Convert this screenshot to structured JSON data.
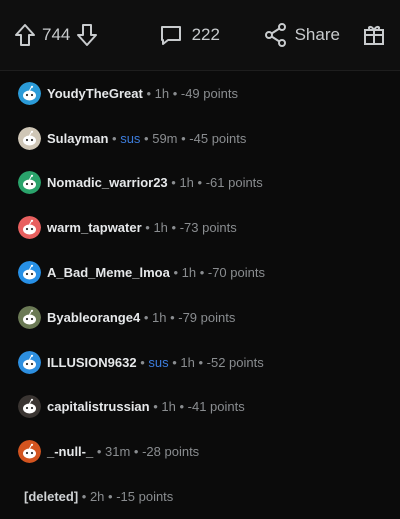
{
  "actions": {
    "upvotes": "744",
    "comments": "222",
    "share_label": "Share"
  },
  "colors": {
    "background": "#0b0b0b",
    "meta": "#8a8d90",
    "flair": "#3d7ddc"
  },
  "comments": [
    {
      "user": "YoudyTheGreat",
      "flair": "",
      "time": "1h",
      "points": "-49 points",
      "avatar_color": "#2b9bd8"
    },
    {
      "user": "Sulayman",
      "flair": "sus",
      "time": "59m",
      "points": "-45 points",
      "avatar_color": "#cfc6b6"
    },
    {
      "user": "Nomadic_warrior23",
      "flair": "",
      "time": "1h",
      "points": "-61 points",
      "avatar_color": "#2aa36b"
    },
    {
      "user": "warm_tapwater",
      "flair": "",
      "time": "1h",
      "points": "-73 points",
      "avatar_color": "#e8605f"
    },
    {
      "user": "A_Bad_Meme_lmoa",
      "flair": "",
      "time": "1h",
      "points": "-70 points",
      "avatar_color": "#2790e6"
    },
    {
      "user": "Byableorange4",
      "flair": "",
      "time": "1h",
      "points": "-79 points",
      "avatar_color": "#6b7a55"
    },
    {
      "user": "ILLUSION9632",
      "flair": "sus",
      "time": "1h",
      "points": "-52 points",
      "avatar_color": "#2d8fe0"
    },
    {
      "user": "capitalistrussian",
      "flair": "",
      "time": "1h",
      "points": "-41 points",
      "avatar_color": "#3a3532"
    },
    {
      "user": "_-null-_",
      "flair": "",
      "time": "31m",
      "points": "-28 points",
      "avatar_color": "#d3541f"
    },
    {
      "user": "[deleted]",
      "flair": "",
      "time": "2h",
      "points": "-15 points",
      "avatar_color": ""
    }
  ]
}
